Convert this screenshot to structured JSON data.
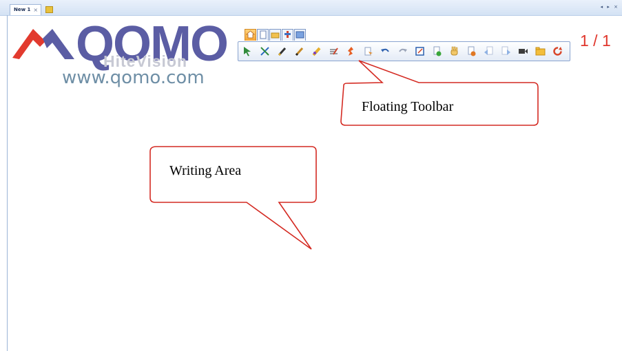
{
  "tabstrip": {
    "tab_label": "New 1",
    "tab_close": "×",
    "nav_controls": "◂ ▸ ×"
  },
  "logo": {
    "brand": "QOMO",
    "sub": "HiteVision",
    "url": "www.qomo.com",
    "colors": {
      "brand": "#5b5da4",
      "mark": "#e23a2e",
      "url": "#6f8fa6"
    }
  },
  "toolbar": {
    "tabs": [
      "home-tab-icon",
      "page-tab-icon",
      "folder-tab-icon",
      "tools-tab-icon",
      "settings-tab-icon"
    ],
    "tools": [
      "select-arrow-icon",
      "select-cross-icon",
      "pen-icon",
      "brush-icon",
      "highlighter-icon",
      "text-recognition-icon",
      "magic-pen-icon",
      "eraser-icon",
      "undo-icon",
      "redo-icon",
      "screen-capture-icon",
      "new-page-icon",
      "hand-roam-icon",
      "page-delete-icon",
      "previous-page-icon",
      "next-page-icon",
      "video-record-icon",
      "open-folder-icon",
      "refresh-icon"
    ]
  },
  "page_indicator": "1 / 1",
  "callouts": {
    "toolbar_label": "Floating Toolbar",
    "writing_label": "Writing Area"
  }
}
